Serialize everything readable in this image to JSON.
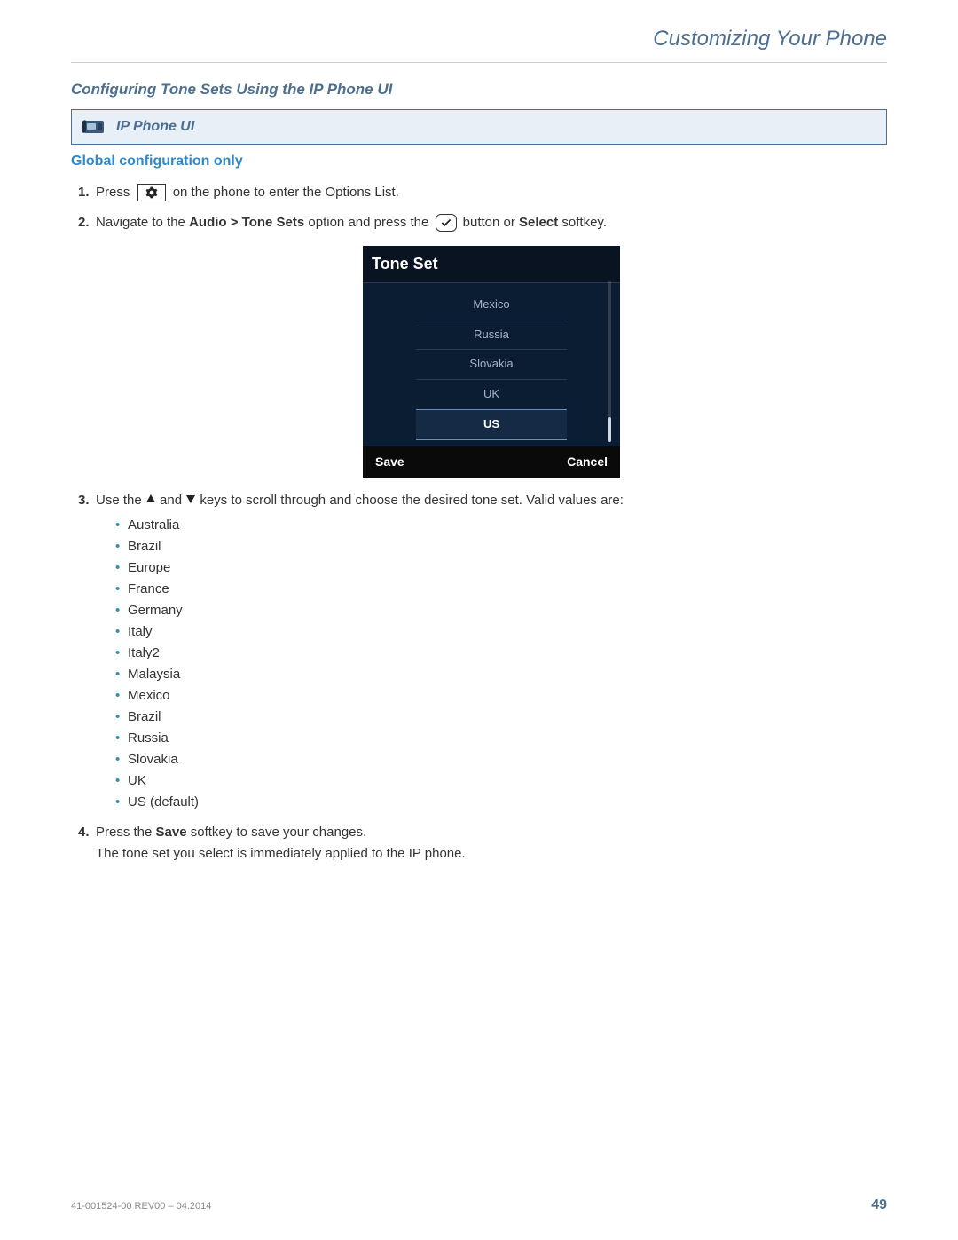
{
  "header": {
    "title": "Customizing Your Phone"
  },
  "section": {
    "title": "Configuring Tone Sets Using the IP Phone UI",
    "ipbox_label": "IP Phone UI",
    "global_conf": "Global configuration only"
  },
  "steps": {
    "s1": {
      "num": "1.",
      "pre": "Press",
      "post": "on the phone to enter the Options List."
    },
    "s2": {
      "num": "2.",
      "pre": "Navigate to the ",
      "bold": "Audio > Tone Sets",
      "mid": " option and press the ",
      "post_a": " button or ",
      "bold2": "Select",
      "post_b": " softkey."
    },
    "s3": {
      "num": "3.",
      "pre": "Use the ",
      "mid": " and ",
      "post": " keys to scroll through and choose the desired tone set. Valid values are:"
    },
    "s4": {
      "num": "4.",
      "pre": "Press the ",
      "bold": "Save",
      "mid": " softkey to save your changes.",
      "line2": "The tone set you select is immediately applied to the IP phone."
    }
  },
  "valid_values": [
    "Australia",
    "Brazil",
    "Europe",
    "France",
    "Germany",
    "Italy",
    "Italy2",
    "Malaysia",
    "Mexico",
    "Brazil",
    "Russia",
    "Slovakia",
    "UK",
    "US (default)"
  ],
  "screenshot": {
    "title": "Tone Set",
    "items": [
      "Mexico",
      "Russia",
      "Slovakia",
      "UK",
      "US"
    ],
    "selected": "US",
    "save": "Save",
    "cancel": "Cancel"
  },
  "footer": {
    "doc": "41-001524-00 REV00 – 04.2014",
    "page": "49"
  }
}
